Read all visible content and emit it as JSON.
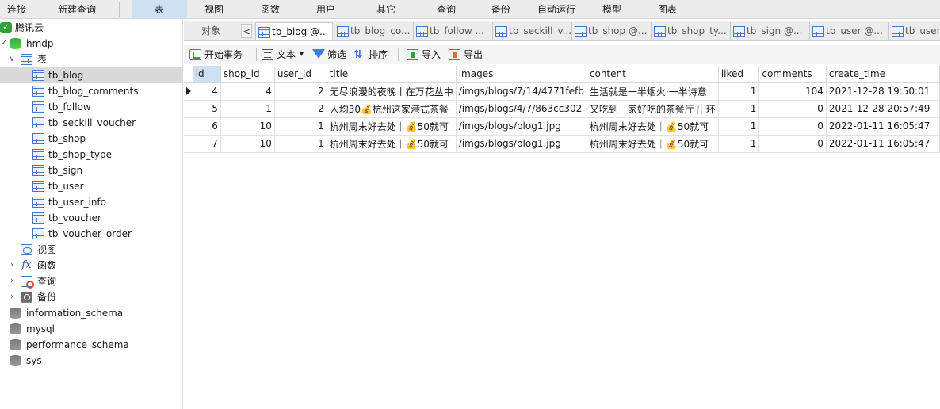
{
  "menu": {
    "items": [
      {
        "label": "连接",
        "active": false
      },
      {
        "label": "新建查询",
        "active": false
      },
      {
        "label": "表",
        "active": true
      },
      {
        "label": "视图",
        "active": false
      },
      {
        "label": "函数",
        "active": false
      },
      {
        "label": "用户",
        "active": false
      },
      {
        "label": "其它",
        "active": false
      },
      {
        "label": "查询",
        "active": false
      },
      {
        "label": "备份",
        "active": false
      },
      {
        "label": "自动运行",
        "active": false
      },
      {
        "label": "模型",
        "active": false
      },
      {
        "label": "图表",
        "active": false
      }
    ]
  },
  "tree": {
    "connection": "腾讯云",
    "database": "hmdp",
    "tables_folder": "表",
    "tables": [
      "tb_blog",
      "tb_blog_comments",
      "tb_follow",
      "tb_seckill_voucher",
      "tb_shop",
      "tb_shop_type",
      "tb_sign",
      "tb_user",
      "tb_user_info",
      "tb_voucher",
      "tb_voucher_order"
    ],
    "selected_table": "tb_blog",
    "views_folder": "视图",
    "functions_folder": "函数",
    "queries_folder": "查询",
    "backups_folder": "备份",
    "other_databases": [
      "information_schema",
      "mysql",
      "performance_schema",
      "sys"
    ]
  },
  "tabs": {
    "objects_label": "对象",
    "nav_left": "<",
    "items": [
      {
        "label": "tb_blog @...",
        "active": true
      },
      {
        "label": "tb_blog_co...",
        "active": false
      },
      {
        "label": "tb_follow ...",
        "active": false
      },
      {
        "label": "tb_seckill_v...",
        "active": false
      },
      {
        "label": "tb_shop @...",
        "active": false
      },
      {
        "label": "tb_shop_ty...",
        "active": false
      },
      {
        "label": "tb_sign @...",
        "active": false
      },
      {
        "label": "tb_user @...",
        "active": false
      },
      {
        "label": "tb_user",
        "active": false
      }
    ]
  },
  "toolbar": {
    "begin_transaction": "开始事务",
    "text": "文本",
    "text_dropdown": "▾",
    "filter": "筛选",
    "sort": "排序",
    "import": "导入",
    "export": "导出"
  },
  "grid": {
    "columns": [
      "id",
      "shop_id",
      "user_id",
      "title",
      "images",
      "content",
      "liked",
      "comments",
      "create_time"
    ],
    "active_column": "id",
    "current_row": 0,
    "rows": [
      [
        "4",
        "4",
        "2",
        "无尽浪漫的夜晚丨在万花丛中",
        "/imgs/blogs/7/14/4771fefb",
        "生活就是一半烟火·一半诗意",
        "1",
        "104",
        "2021-12-28 19:50:01"
      ],
      [
        "5",
        "1",
        "2",
        "人均30💰杭州这家港式茶餐",
        "/imgs/blogs/4/7/863cc302",
        "又吃到一家好吃的茶餐厅🍴环",
        "1",
        "0",
        "2021-12-28 20:57:49"
      ],
      [
        "6",
        "10",
        "1",
        "杭州周末好去处｜💰50就可",
        "/imgs/blogs/blog1.jpg",
        "杭州周末好去处｜💰50就可",
        "1",
        "0",
        "2022-01-11 16:05:47"
      ],
      [
        "7",
        "10",
        "1",
        "杭州周末好去处｜💰50就可",
        "/imgs/blogs/blog1.jpg",
        "杭州周末好去处｜💰50就可",
        "1",
        "0",
        "2022-01-11 16:05:47"
      ]
    ]
  }
}
